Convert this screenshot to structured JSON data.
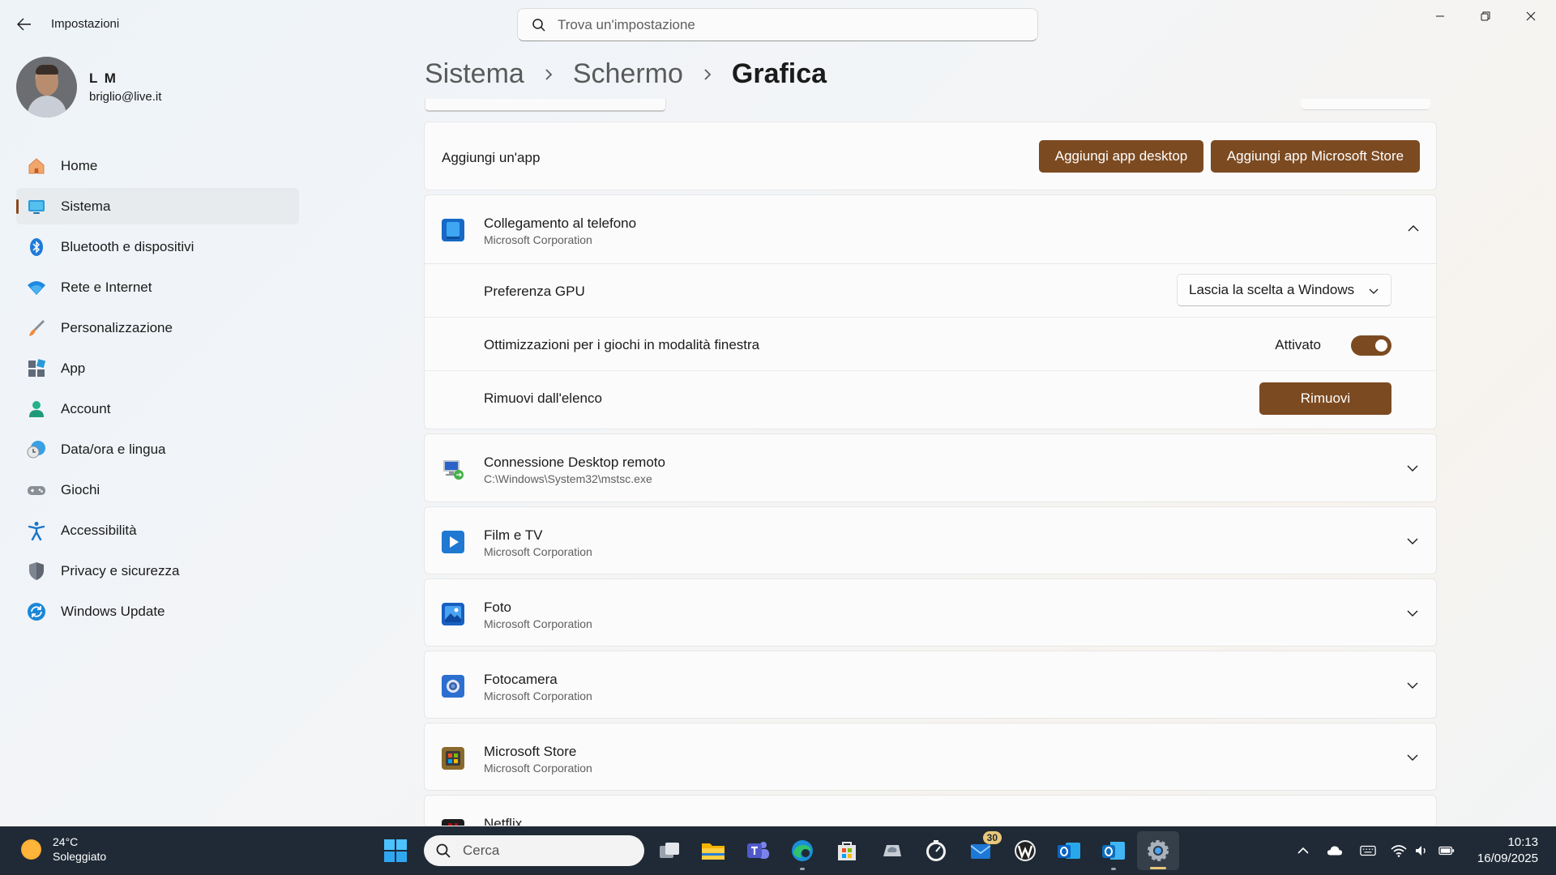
{
  "window": {
    "title": "Impostazioni",
    "search_placeholder": "Trova un'impostazione"
  },
  "profile": {
    "name": "L M",
    "email": "briglio@live.it"
  },
  "sidebar": {
    "items": [
      {
        "label": "Home",
        "icon": "home-icon",
        "active": false
      },
      {
        "label": "Sistema",
        "icon": "system-icon",
        "active": true
      },
      {
        "label": "Bluetooth e dispositivi",
        "icon": "bluetooth-icon",
        "active": false
      },
      {
        "label": "Rete e Internet",
        "icon": "wifi-icon",
        "active": false
      },
      {
        "label": "Personalizzazione",
        "icon": "brush-icon",
        "active": false
      },
      {
        "label": "App",
        "icon": "apps-icon",
        "active": false
      },
      {
        "label": "Account",
        "icon": "account-icon",
        "active": false
      },
      {
        "label": "Data/ora e lingua",
        "icon": "clock-globe-icon",
        "active": false
      },
      {
        "label": "Giochi",
        "icon": "gamepad-icon",
        "active": false
      },
      {
        "label": "Accessibilità",
        "icon": "accessibility-icon",
        "active": false
      },
      {
        "label": "Privacy e sicurezza",
        "icon": "shield-icon",
        "active": false
      },
      {
        "label": "Windows Update",
        "icon": "update-icon",
        "active": false
      }
    ]
  },
  "breadcrumb": [
    "Sistema",
    "Schermo",
    "Grafica"
  ],
  "add_app": {
    "label": "Aggiungi un'app",
    "desktop_button": "Aggiungi app desktop",
    "store_button": "Aggiungi app Microsoft Store"
  },
  "expanded_app": {
    "name": "Collegamento al telefono",
    "publisher": "Microsoft Corporation",
    "gpu_label": "Preferenza GPU",
    "gpu_value": "Lascia la scelta a Windows",
    "optim_label": "Ottimizzazioni per i giochi in modalità finestra",
    "optim_state": "Attivato",
    "remove_label": "Rimuovi dall'elenco",
    "remove_button": "Rimuovi"
  },
  "apps": [
    {
      "name": "Connessione Desktop remoto",
      "sub": "C:\\Windows\\System32\\mstsc.exe",
      "icon": "remote-desktop-icon"
    },
    {
      "name": "Film e TV",
      "sub": "Microsoft Corporation",
      "icon": "film-tv-icon"
    },
    {
      "name": "Foto",
      "sub": "Microsoft Corporation",
      "icon": "photos-icon"
    },
    {
      "name": "Fotocamera",
      "sub": "Microsoft Corporation",
      "icon": "camera-icon"
    },
    {
      "name": "Microsoft Store",
      "sub": "Microsoft Corporation",
      "icon": "store-icon"
    },
    {
      "name": "Netflix",
      "sub": "",
      "icon": "netflix-icon"
    }
  ],
  "taskbar": {
    "weather_temp": "24°C",
    "weather_desc": "Soleggiato",
    "search_label": "Cerca",
    "mail_badge": "30",
    "time": "10:13",
    "date": "16/09/2025"
  },
  "colors": {
    "accent": "#7c4a21",
    "taskbar": "#1f2a36"
  }
}
